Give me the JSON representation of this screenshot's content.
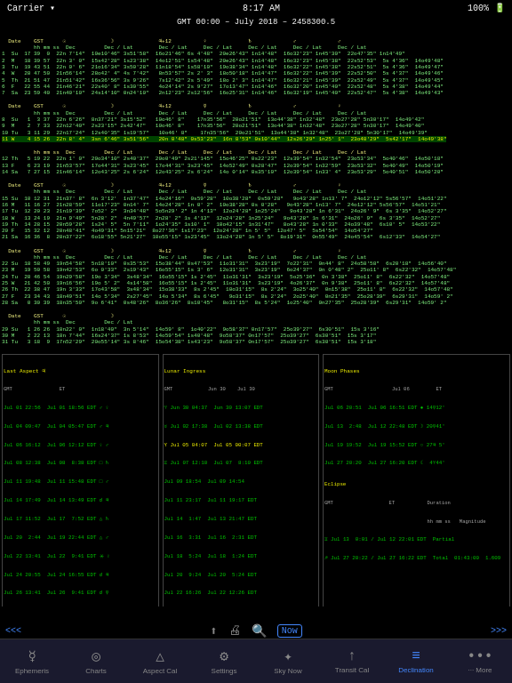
{
  "statusBar": {
    "carrier": "Carrier",
    "wifi": "WiFi",
    "time": "8:17 AM",
    "battery": "100%"
  },
  "titleBar": {
    "text": "GMT 00:00 – July 2018 – 2458300.5"
  },
  "navigation": {
    "items": [
      {
        "id": "ephemeris",
        "label": "Ephemeris",
        "icon": "☿",
        "active": false
      },
      {
        "id": "charts",
        "label": "Charts",
        "icon": "◎",
        "active": false
      },
      {
        "id": "aspect-cal",
        "label": "Aspect Cal",
        "icon": "△",
        "active": false
      },
      {
        "id": "settings",
        "label": "Settings",
        "icon": "⚙",
        "active": false
      },
      {
        "id": "sky-now",
        "label": "Sky Now",
        "icon": "✦",
        "active": false
      },
      {
        "id": "transit-cal",
        "label": "Transit Cal",
        "icon": "↑",
        "active": false
      },
      {
        "id": "declination",
        "label": "Declination",
        "icon": "≡",
        "active": true
      },
      {
        "id": "more",
        "label": "··· More",
        "icon": "",
        "active": false
      }
    ]
  },
  "prevButton": "<<<",
  "nextButton": ">>>"
}
